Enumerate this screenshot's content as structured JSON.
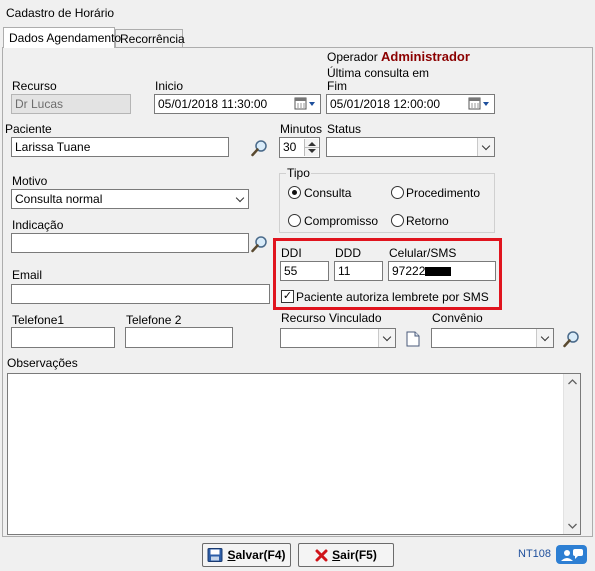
{
  "window": {
    "title": "Cadastro de Horário"
  },
  "tabs": [
    {
      "label": "Dados Agendamento",
      "active": true
    },
    {
      "label": "Recorrência",
      "active": false
    }
  ],
  "operator": {
    "label": "Operador",
    "name": "Administrador",
    "last_query": "Última consulta em",
    "last_query_value": ""
  },
  "recurso": {
    "label": "Recurso",
    "value": "Dr Lucas"
  },
  "inicio": {
    "label": "Inicio",
    "value": "05/01/2018 11:30:00"
  },
  "fim": {
    "label": "Fim",
    "value": "05/01/2018 12:00:00"
  },
  "paciente": {
    "label": "Paciente",
    "value": "Larissa Tuane"
  },
  "minutos": {
    "label": "Minutos",
    "value": "30"
  },
  "status": {
    "label": "Status",
    "value": ""
  },
  "motivo": {
    "label": "Motivo",
    "value": "Consulta normal"
  },
  "tipo": {
    "label": "Tipo",
    "options": [
      {
        "label": "Consulta",
        "selected": true
      },
      {
        "label": "Procedimento",
        "selected": false
      },
      {
        "label": "Compromisso",
        "selected": false
      },
      {
        "label": "Retorno",
        "selected": false
      }
    ]
  },
  "indicacao": {
    "label": "Indicação",
    "value": ""
  },
  "email": {
    "label": "Email",
    "value": ""
  },
  "sms": {
    "ddi_label": "DDI",
    "ddi_value": "55",
    "ddd_label": "DDD",
    "ddd_value": "11",
    "celular_label": "Celular/SMS",
    "celular_value": "97222",
    "authorize_label": "Paciente autoriza lembrete por SMS",
    "authorize_checked": true,
    "highlight_color": "#e0141e"
  },
  "telefone1": {
    "label": "Telefone1",
    "value": ""
  },
  "telefone2": {
    "label": "Telefone 2",
    "value": ""
  },
  "recurso_vinculado": {
    "label": "Recurso Vinculado",
    "value": ""
  },
  "convenio": {
    "label": "Convênio",
    "value": ""
  },
  "observacoes": {
    "label": "Observações",
    "value": ""
  },
  "footer": {
    "save_label": "alvar(F4)",
    "save_prefix": "S",
    "exit_label": "air(F5)",
    "exit_prefix": "S",
    "code": "NT108"
  },
  "colors": {
    "operator_name": "#8b0000",
    "code": "#1e4f9c",
    "accent_blue": "#2d7fd3"
  }
}
